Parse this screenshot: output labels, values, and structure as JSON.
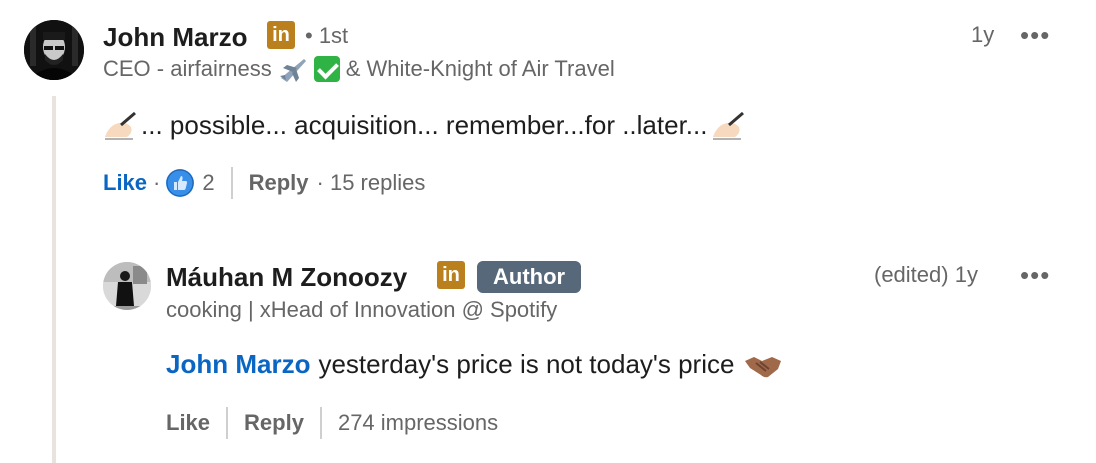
{
  "comment": {
    "author_name": "John Marzo",
    "linkedin_badge": "in",
    "degree": "• 1st",
    "headline_prefix": "CEO - airfairness",
    "headline_suffix": "& White-Knight of Air Travel",
    "headline_emoji_icons": [
      "airplane-emoji-icon",
      "check-mark-emoji-icon"
    ],
    "time": "1y",
    "more_label": "•••",
    "text": "... possible... acquisition... remember...for ..later...",
    "text_emoji_icons": [
      "writing-hand-emoji-icon",
      "writing-hand-emoji-icon"
    ],
    "actions": {
      "like_label": "Like",
      "dot": "·",
      "reaction_count": "2",
      "reaction_icon": "thumbs-up-icon",
      "reply_label": "Reply",
      "replies_text": "· 15 replies"
    }
  },
  "reply": {
    "author_name": "Máuhan M Zonoozy",
    "linkedin_badge": "in",
    "author_badge": "Author",
    "headline": "cooking | xHead of Innovation @ Spotify",
    "time": "(edited) 1y",
    "more_label": "•••",
    "mention": "John Marzo",
    "text": "yesterday's price is not today's price",
    "text_emoji_icons": [
      "handshake-emoji-icon"
    ],
    "actions": {
      "like_label": "Like",
      "reply_label": "Reply",
      "impressions": "274 impressions"
    }
  },
  "colors": {
    "link_blue": "#0a66c2",
    "linkedin_badge_gold": "#b9801d",
    "author_badge_gray": "#56687a",
    "muted_text": "#666666",
    "thread_line": "#e8e3dc"
  }
}
